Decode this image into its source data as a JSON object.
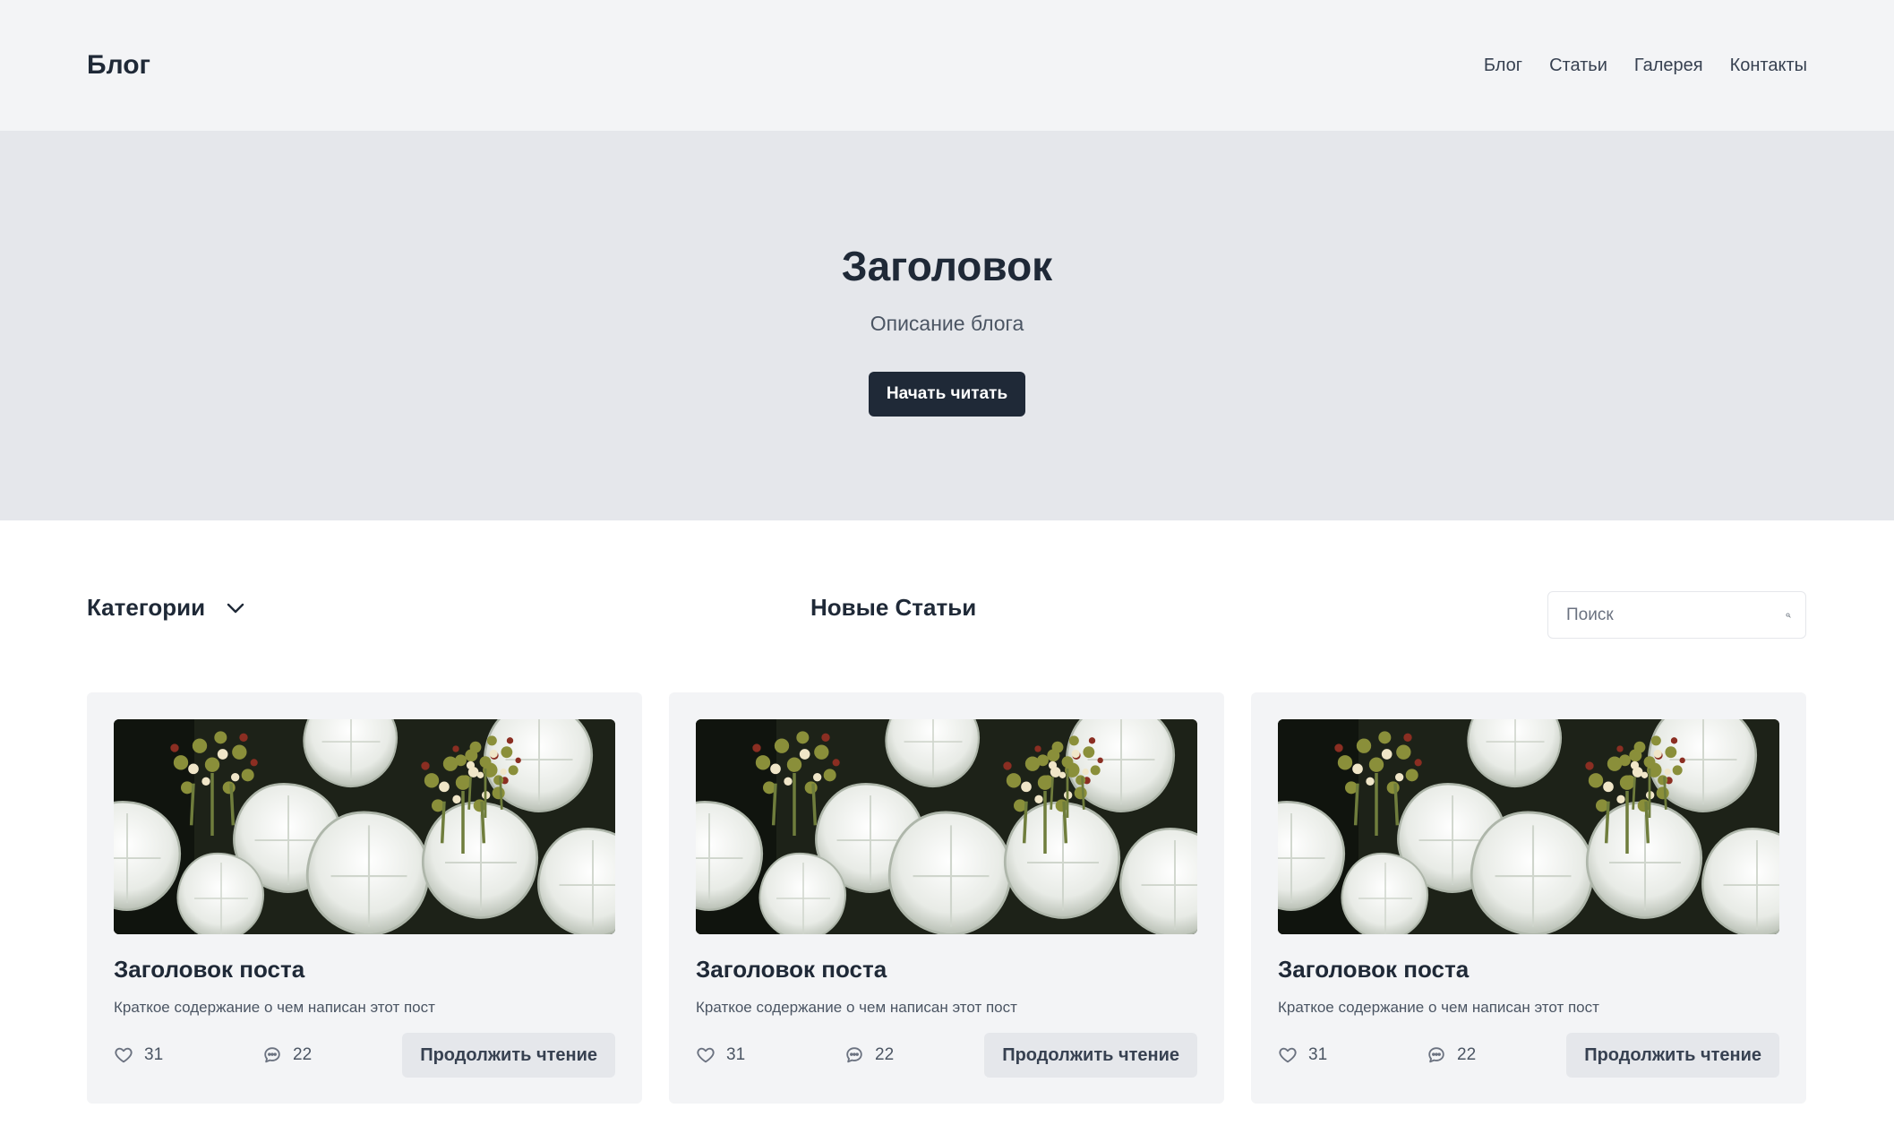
{
  "header": {
    "brand": "Блог",
    "nav": [
      "Блог",
      "Статьи",
      "Галерея",
      "Контакты"
    ]
  },
  "hero": {
    "title": "Заголовок",
    "subtitle": "Описание блога",
    "cta_label": "Начать читать"
  },
  "toolbar": {
    "categories_label": "Категории",
    "section_title": "Новые Статьи",
    "search_placeholder": "Поиск"
  },
  "posts": [
    {
      "title": "Заголовок поста",
      "excerpt": "Краткое содержание о чем написан этот пост",
      "likes": "31",
      "comments": "22",
      "read_more": "Продолжить чтение"
    },
    {
      "title": "Заголовок поста",
      "excerpt": "Краткое содержание о чем написан этот пост",
      "likes": "31",
      "comments": "22",
      "read_more": "Продолжить чтение"
    },
    {
      "title": "Заголовок поста",
      "excerpt": "Краткое содержание о чем написан этот пост",
      "likes": "31",
      "comments": "22",
      "read_more": "Продолжить чтение"
    }
  ],
  "icons": {
    "categories": "chevron-down-icon",
    "search": "search-icon",
    "likes": "heart-icon",
    "comments": "comment-icon"
  },
  "colors": {
    "header_bg": "#f3f4f6",
    "hero_bg": "#e5e7eb",
    "primary": "#1f2937",
    "card_bg": "#f3f4f6"
  }
}
